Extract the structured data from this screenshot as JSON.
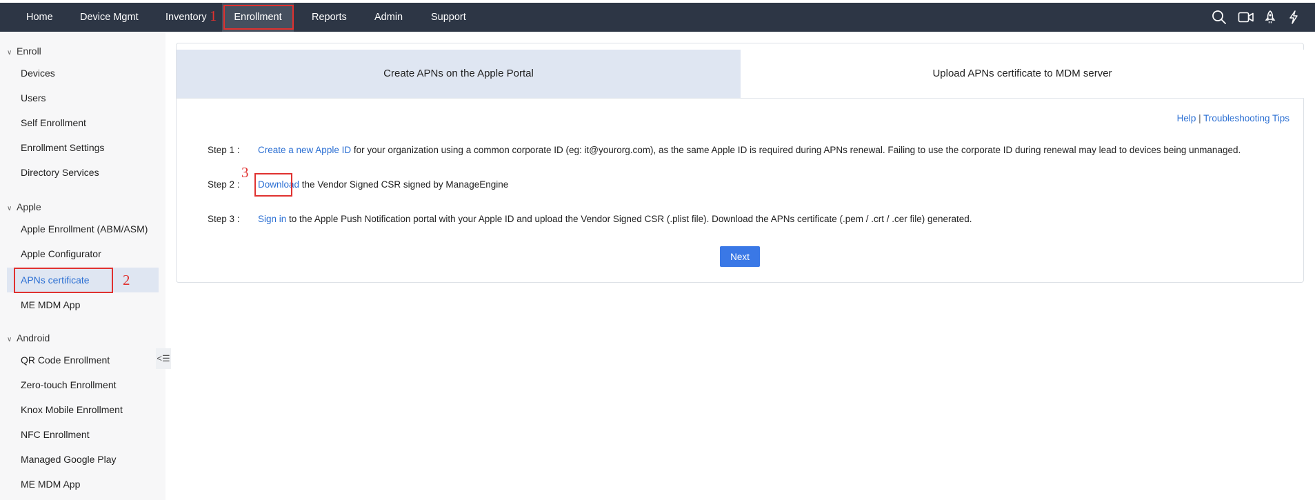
{
  "topnav": {
    "items": [
      "Home",
      "Device Mgmt",
      "Inventory",
      "Enrollment",
      "Reports",
      "Admin",
      "Support"
    ],
    "active": "Enrollment",
    "icons": [
      "search-icon",
      "video-icon",
      "rocket-icon",
      "lightning-icon"
    ]
  },
  "annotations": {
    "n1": "1",
    "n2": "2",
    "n3": "3",
    "color": "#e0312f"
  },
  "sidebar": {
    "sections": [
      {
        "title": "Enroll",
        "items": [
          "Devices",
          "Users",
          "Self Enrollment",
          "Enrollment Settings",
          "Directory Services"
        ]
      },
      {
        "title": "Apple",
        "items": [
          "Apple Enrollment (ABM/ASM)",
          "Apple Configurator",
          "APNs certificate",
          "ME MDM App"
        ]
      },
      {
        "title": "Android",
        "items": [
          "QR Code Enrollment",
          "Zero-touch Enrollment",
          "Knox Mobile Enrollment",
          "NFC Enrollment",
          "Managed Google Play",
          "ME MDM App"
        ]
      }
    ],
    "active_item": "APNs certificate",
    "collapse_icon": "collapse-sidebar-icon"
  },
  "main": {
    "tabs": [
      "Create APNs on the Apple Portal",
      "Upload APNs certificate to MDM server"
    ],
    "help_link": "Help",
    "help_sep": "|",
    "troubleshoot_link": "Troubleshooting Tips",
    "steps": [
      {
        "label": "Step 1 :",
        "link": "Create a new Apple ID",
        "text": " for your organization using a common corporate ID (eg: it@yourorg.com), as the same Apple ID is required during APNs renewal. Failing to use the corporate ID during renewal may lead to devices being unmanaged."
      },
      {
        "label": "Step 2 :",
        "link": "Download",
        "text": " the Vendor Signed CSR signed by ManageEngine"
      },
      {
        "label": "Step 3 :",
        "link": "Sign in",
        "text": " to the Apple Push Notification portal with your Apple ID and upload the Vendor Signed CSR (.plist file). Download the APNs certificate (.pem / .crt / .cer file) generated."
      }
    ],
    "next_button": "Next"
  },
  "colors": {
    "nav_bg": "#2d3645",
    "accent": "#3a78e6",
    "link": "#2b6fd3",
    "active_bg": "#dfe6f2"
  }
}
